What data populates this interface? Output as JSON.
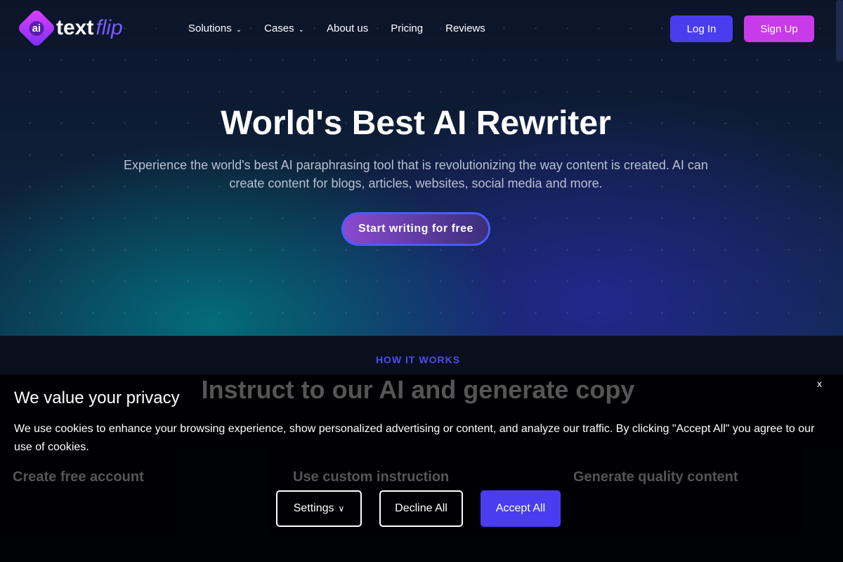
{
  "nav": {
    "logo_mark": "ai",
    "logo_text1": "text",
    "logo_text2": "flip",
    "items": [
      {
        "label": "Solutions",
        "dropdown": true
      },
      {
        "label": "Cases",
        "dropdown": true
      },
      {
        "label": "About us"
      },
      {
        "label": "Pricing"
      },
      {
        "label": "Reviews"
      }
    ],
    "login": "Log In",
    "signup": "Sign Up"
  },
  "hero": {
    "title": "World's Best AI Rewriter",
    "subtitle": "Experience the world's best AI paraphrasing tool that is revolutionizing the way content is created. AI can create content for blogs, articles, websites, social media and more.",
    "cta": "Start writing for free"
  },
  "how": {
    "label": "HOW IT WORKS",
    "title": "Instruct to our AI and generate copy",
    "cols": [
      "Create free account",
      "Use custom instruction",
      "Generate quality content"
    ]
  },
  "cookie": {
    "title": "We value your privacy",
    "text": "We use cookies to enhance your browsing experience, show personalized advertising or content, and analyze our traffic. By clicking \"Accept All\" you agree to our use of cookies.",
    "close": "x",
    "settings": "Settings",
    "decline": "Decline All",
    "accept": "Accept All"
  },
  "colors": {
    "accent": "#4a3df0",
    "signup": "#c73ce8"
  }
}
